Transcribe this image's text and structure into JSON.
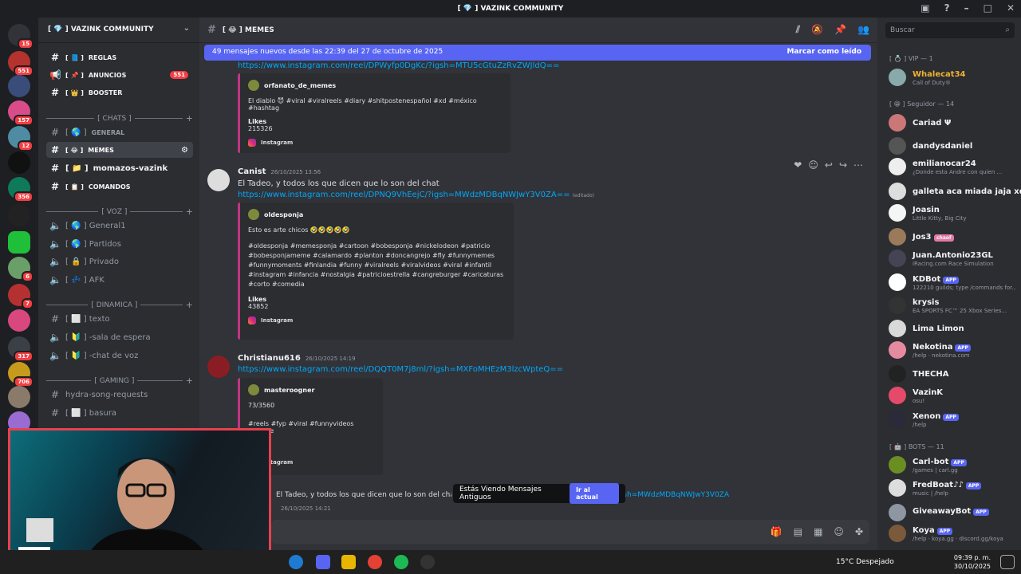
{
  "window": {
    "title": "[ 💎 ] VAZINK COMMUNITY"
  },
  "server": {
    "name": "[ 💎 ] VAZINK COMMUNITY",
    "channels": [
      {
        "label": "REGLAS",
        "prefix": "[ 📘 ]"
      },
      {
        "label": "ANUNCIOS",
        "prefix": "[ 📌 ]",
        "badge": "551"
      },
      {
        "label": "BOOSTER",
        "prefix": "[ 👑 ]"
      }
    ],
    "categories": [
      "[ CHATS ]",
      "[ VOZ ]",
      "[ DINAMICA ]",
      "[ GAMING ]"
    ],
    "chats": [
      {
        "label": "GENERAL",
        "prefix": "[ 🌎 ]"
      },
      {
        "label": "MEMES",
        "prefix": "[ 😂 ]"
      },
      {
        "label": "momazos-vazink",
        "prefix": "[ 📁 ]"
      },
      {
        "label": "COMANDOS",
        "prefix": "[ 📋 ]"
      }
    ],
    "voice": [
      "[ 🌎 ] General1",
      "[ 🌎 ] Partidos",
      "[ 🔒 ] Privado",
      "[ 💤 ] AFK"
    ],
    "dinamica": [
      "[ ⬜ ] texto",
      "[ 🔰 ] -sala de espera",
      "[ 🔰 ] -chat de voz"
    ],
    "gaming": [
      "hydra-song-requests",
      "[ ⬜ ] basura"
    ]
  },
  "server_badges": [
    "15",
    "551",
    "157",
    "12",
    "356",
    "6",
    "7",
    "317",
    "706"
  ],
  "channel_header": {
    "name": "[ 😂 ] MEMES"
  },
  "new_messages": {
    "text": "49 mensajes nuevos desde las 22:39 del 27 de octubre de 2025",
    "action": "Marcar como leído"
  },
  "messages": [
    {
      "link": "https://www.instagram.com/reel/DPWyfp0DgKc/?igsh=MTU5cGtuZzRvZWJldQ==",
      "embed": {
        "author": "orfanato_de_memes",
        "desc": "El diablo 😈 #viral #viralreels #diary #shitpostenespañol #xd #méxico #hashtag",
        "field": "Likes",
        "value": "215326",
        "footer": "Instagram"
      }
    },
    {
      "user": "Canist",
      "time": "26/10/2025 13:56",
      "text": "El Tadeo, y todos los que dicen que lo son del chat",
      "link": "https://www.instagram.com/reel/DPNQ9VhEejC/?igsh=MWdzMDBqNWJwY3V0ZA==",
      "edited": "(editado)",
      "embed": {
        "author": "oldesponja",
        "desc": "Esto es arte chicos 🤣🤣🤣🤣🤣",
        "tags": "#oldesponja #memesponja #cartoon #bobesponja #nickelodeon #patricio #bobesponjameme #calamardo #planton #doncangrejo #fly #funnymemes #funnymoments #finlandia #funny #viralreels #viralvideos #viral #infantil #instagram #infancia #nostalgia #patricioestrella #cangreburger #caricaturas #corto #comedia",
        "field": "Likes",
        "value": "43852",
        "footer": "Instagram"
      }
    },
    {
      "user": "Christianu616",
      "time": "26/10/2025 14:19",
      "link": "https://www.instagram.com/reel/DQQT0M7j8ml/?igsh=MXFoMHEzM3lzcWpteQ==",
      "embed": {
        "author": "masteroogner",
        "desc": "73/3560",
        "tags": "#reels #fyp #viral #funnyvideos #meme",
        "footer": "Instagram"
      }
    },
    {
      "text": "El Tadeo, y todos los que dicen que lo son del chat",
      "link_tail": "https://www.instagram.com/reel/DPNQ9VhEejC/?igsh=MWdzMDBqNWJwY3V0ZA==",
      "edited": "(editado)",
      "time": "26/10/2025 14:21"
    }
  ],
  "jump": {
    "label": "Estás Viendo Mensajes Antiguos",
    "button": "Ir al actual"
  },
  "search": {
    "placeholder": "Buscar"
  },
  "members": {
    "vip": "[ 💍 ] VIP — 1",
    "seguidor": "[ 😁 ] Seguidor — 14",
    "bots": "[ 🤖 ] BOTS — 11",
    "list": [
      {
        "name": "Whalecat34",
        "status": "Call of Duty®",
        "color": "#f0b232"
      },
      {
        "name": "Cariad Ψ",
        "status": ""
      },
      {
        "name": "dandysdaniel",
        "status": ""
      },
      {
        "name": "emilianocar24",
        "status": "¿Donde esta Andre con quien ..."
      },
      {
        "name": "galleta aca miada jaja xd",
        "status": ""
      },
      {
        "name": "Joasin",
        "status": "Little Kitty, Big City"
      },
      {
        "name": "Jos3",
        "status": "",
        "tag": "chaof"
      },
      {
        "name": "Juan.Antonio23GL",
        "status": "iRacing.com Race Simulation"
      },
      {
        "name": "KDBot",
        "status": "122210 guilds; type /commands for...",
        "app": "APP"
      },
      {
        "name": "krysis",
        "status": "EA SPORTS FC™ 25 Xbox Series..."
      },
      {
        "name": "Lima Limon",
        "status": ""
      },
      {
        "name": "Nekotina",
        "status": "/help · nekotina.com",
        "app": "APP"
      },
      {
        "name": "THECHA",
        "status": ""
      },
      {
        "name": "VazinK",
        "status": "osu!"
      },
      {
        "name": "Xenon",
        "status": "/help",
        "app": "APP"
      },
      {
        "name": "Carl-bot",
        "status": "/games | carl.gg",
        "app": "APP"
      },
      {
        "name": "FredBoat♪♪",
        "status": "music | /help",
        "app": "APP"
      },
      {
        "name": "GiveawayBot",
        "status": "",
        "app": "APP"
      },
      {
        "name": "Koya",
        "status": "/help · koya.gg · discord.gg/koya",
        "app": "APP"
      }
    ]
  },
  "taskbar": {
    "weather": "15°C  Despejado",
    "time": "09:39 p. m.",
    "date": "30/10/2025"
  },
  "colors": {
    "accent": "#5865f2",
    "bg": "#313338",
    "sidebar": "#2b2d31",
    "link": "#00a8fc"
  }
}
